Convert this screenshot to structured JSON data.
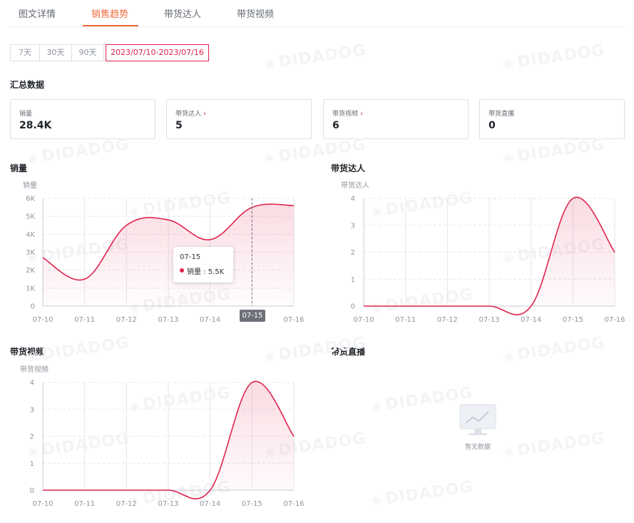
{
  "tabs": [
    {
      "label": "图文详情",
      "active": false
    },
    {
      "label": "销售趋势",
      "active": true
    },
    {
      "label": "带货达人",
      "active": false
    },
    {
      "label": "带货视频",
      "active": false
    }
  ],
  "date_ranges": [
    {
      "label": "7天",
      "active": false
    },
    {
      "label": "30天",
      "active": false
    },
    {
      "label": "90天",
      "active": false
    },
    {
      "label": "2023/07/10-2023/07/16",
      "active": true
    }
  ],
  "summary": {
    "title": "汇总数据",
    "cards": [
      {
        "label": "销量",
        "value": "28.4K",
        "has_arrow": false
      },
      {
        "label": "带货达人",
        "value": "5",
        "has_arrow": true
      },
      {
        "label": "带货视频",
        "value": "6",
        "has_arrow": true
      },
      {
        "label": "带货直播",
        "value": "0",
        "has_arrow": false
      }
    ]
  },
  "watermark": "DIDADOG",
  "colors": {
    "accent": "#ee6a3c",
    "series": "#e0234d",
    "grid": "#e4e6eb"
  },
  "chart_data": [
    {
      "type": "area",
      "title": "销量",
      "ylabel": "销量",
      "x": [
        "07-10",
        "07-11",
        "07-12",
        "07-13",
        "07-14",
        "07-15",
        "07-16"
      ],
      "y_ticks": [
        "0",
        "1K",
        "2K",
        "3K",
        "4K",
        "5K",
        "6K"
      ],
      "ylim": [
        0,
        6000
      ],
      "values": [
        2700,
        1500,
        4500,
        4800,
        3700,
        5500,
        5600
      ],
      "grid": true,
      "tooltip": {
        "date": "07-15",
        "label": "销量 : 5.5K"
      },
      "crosshair_label": "07-15"
    },
    {
      "type": "area",
      "title": "带货达人",
      "ylabel": "带货达人",
      "x": [
        "07-10",
        "07-11",
        "07-12",
        "07-13",
        "07-14",
        "07-15",
        "07-16"
      ],
      "y_ticks": [
        "0",
        "1",
        "2",
        "3",
        "4"
      ],
      "ylim": [
        0,
        4
      ],
      "values": [
        0,
        0,
        0,
        0,
        0,
        4,
        2
      ],
      "grid": true
    },
    {
      "type": "area",
      "title": "带货视频",
      "ylabel": "带货视频",
      "x": [
        "07-10",
        "07-11",
        "07-12",
        "07-13",
        "07-14",
        "07-15",
        "07-16"
      ],
      "y_ticks": [
        "0",
        "1",
        "2",
        "3",
        "4"
      ],
      "ylim": [
        0,
        4
      ],
      "values": [
        0,
        0,
        0,
        0,
        0,
        4,
        2
      ],
      "grid": true
    },
    {
      "type": "area",
      "title": "带货直播",
      "empty": true,
      "empty_text": "暂无数据"
    }
  ]
}
